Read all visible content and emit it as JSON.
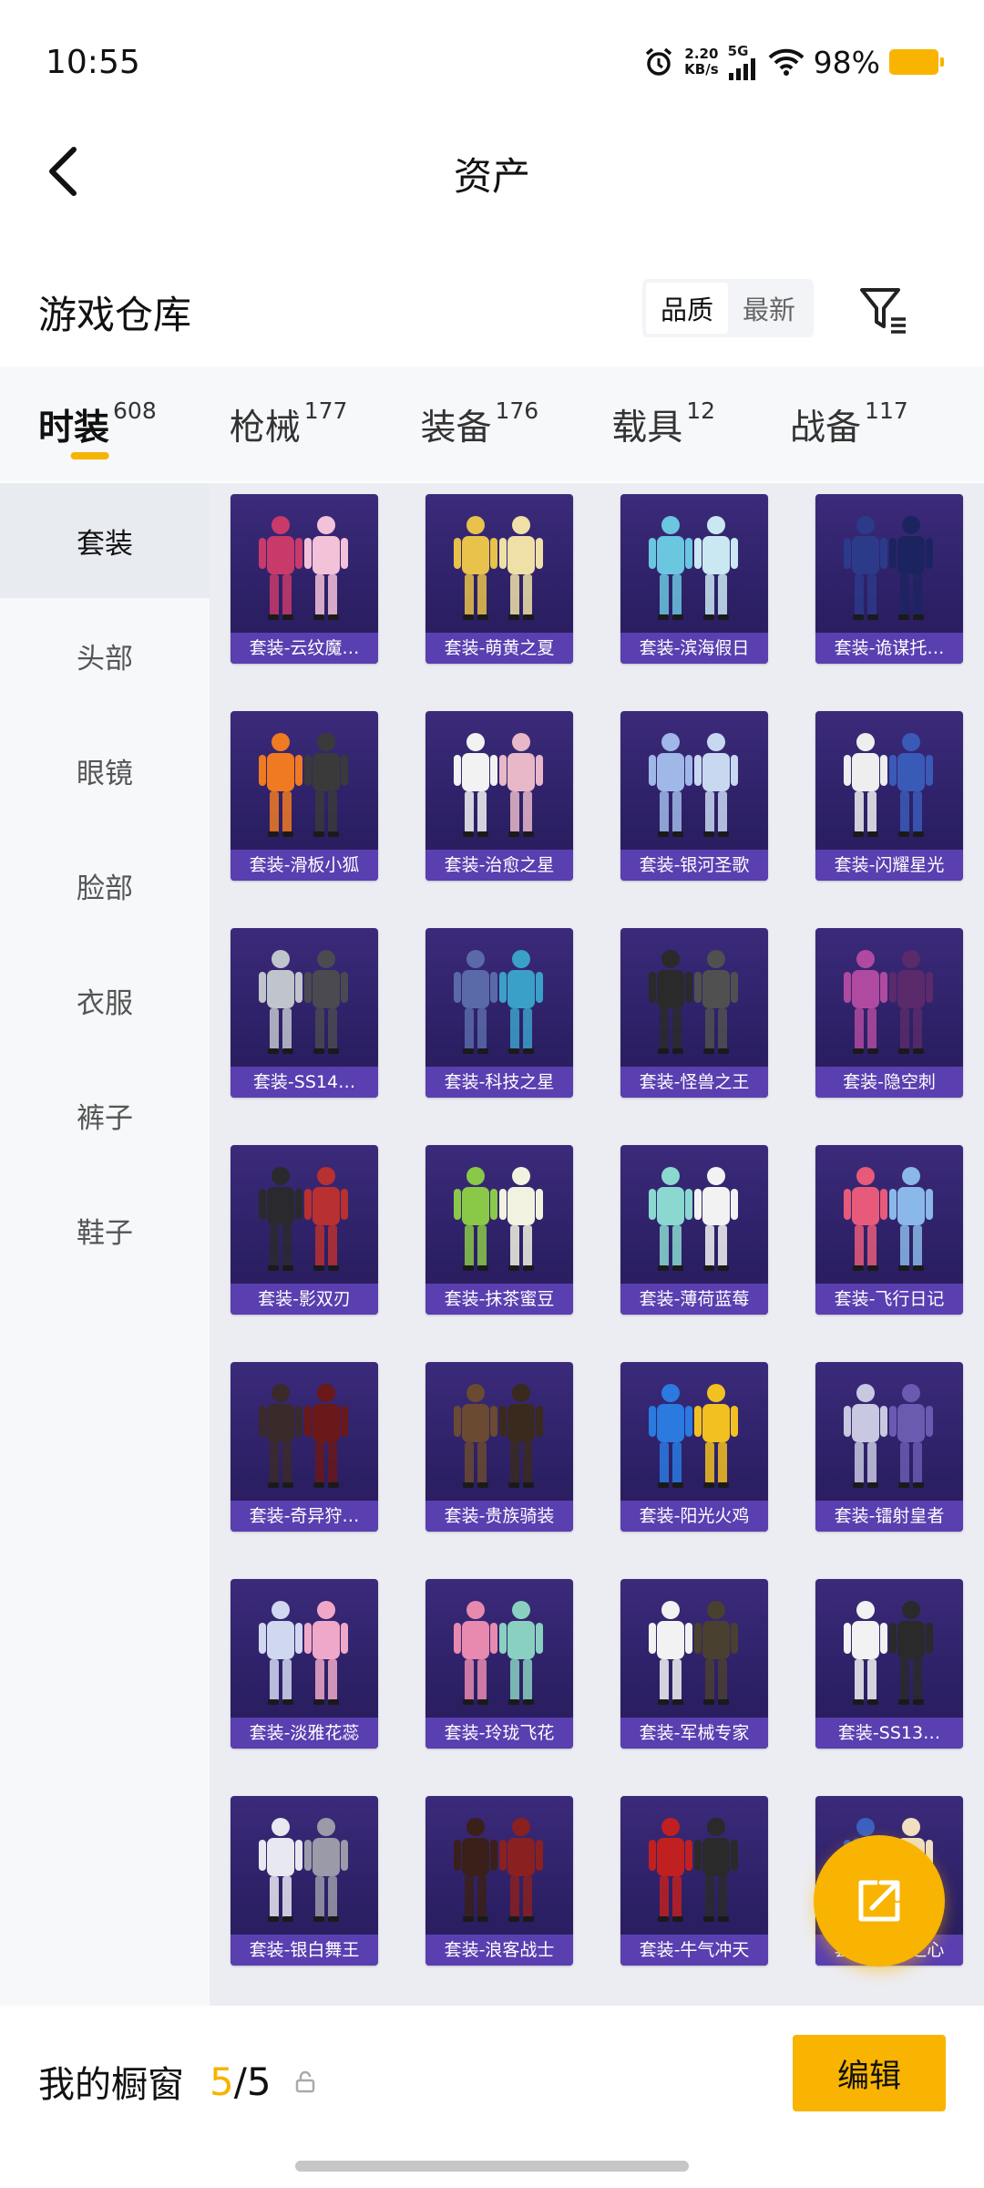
{
  "status_bar": {
    "time": "10:55",
    "net_speed_value": "2.20",
    "net_speed_unit": "KB/s",
    "network": "5G",
    "battery": "98%"
  },
  "nav": {
    "title": "资产"
  },
  "warehouse": {
    "title": "游戏仓库",
    "sort_options": [
      "品质",
      "最新"
    ],
    "active_sort": "品质"
  },
  "tabs": [
    {
      "label": "时装",
      "count": "608",
      "active": true
    },
    {
      "label": "枪械",
      "count": "177"
    },
    {
      "label": "装备",
      "count": "176"
    },
    {
      "label": "载具",
      "count": "12"
    },
    {
      "label": "战备",
      "count": "117"
    }
  ],
  "categories": [
    {
      "label": "套装",
      "active": true
    },
    {
      "label": "头部"
    },
    {
      "label": "眼镜"
    },
    {
      "label": "脸部"
    },
    {
      "label": "衣服"
    },
    {
      "label": "裤子"
    },
    {
      "label": "鞋子"
    }
  ],
  "items": [
    {
      "name": "套装-云纹魔…",
      "colors": [
        "#c83a6a",
        "#f3c2d8"
      ]
    },
    {
      "name": "套装-萌黄之夏",
      "colors": [
        "#e8c24a",
        "#efe0a8"
      ]
    },
    {
      "name": "套装-滨海假日",
      "colors": [
        "#6bc6e0",
        "#c9e8f2"
      ]
    },
    {
      "name": "套装-诡谋托…",
      "colors": [
        "#2c3a8a",
        "#1c2460"
      ]
    },
    {
      "name": "套装-滑板小狐",
      "colors": [
        "#f07a22",
        "#3a3a3a"
      ]
    },
    {
      "name": "套装-治愈之星",
      "colors": [
        "#f2f2f2",
        "#e8b8c8"
      ]
    },
    {
      "name": "套装-银河圣歌",
      "colors": [
        "#9fb8e8",
        "#c8d8f0"
      ]
    },
    {
      "name": "套装-闪耀星光",
      "colors": [
        "#eeeeee",
        "#3a5ab8"
      ]
    },
    {
      "name": "套装-SS14…",
      "colors": [
        "#c0c4cc",
        "#4a4a50"
      ]
    },
    {
      "name": "套装-科技之星",
      "colors": [
        "#5a6aa8",
        "#3aa0c8"
      ]
    },
    {
      "name": "套装-怪兽之王",
      "colors": [
        "#2a2a2a",
        "#505050"
      ]
    },
    {
      "name": "套装-隐空刺",
      "colors": [
        "#b04aa0",
        "#5a2a6a"
      ]
    },
    {
      "name": "套装-影双刃",
      "colors": [
        "#2a2a2e",
        "#b83030"
      ]
    },
    {
      "name": "套装-抹茶蜜豆",
      "colors": [
        "#8ac848",
        "#f2f2e0"
      ]
    },
    {
      "name": "套装-薄荷蓝莓",
      "colors": [
        "#8ad8d0",
        "#f2f2f2"
      ]
    },
    {
      "name": "套装-飞行日记",
      "colors": [
        "#e85a7a",
        "#8ab8e8"
      ]
    },
    {
      "name": "套装-奇异狩…",
      "colors": [
        "#3a2a2a",
        "#6a1818"
      ]
    },
    {
      "name": "套装-贵族骑装",
      "colors": [
        "#6a4a30",
        "#3a2a1e"
      ]
    },
    {
      "name": "套装-阳光火鸡",
      "colors": [
        "#2a7ae0",
        "#f2c020"
      ]
    },
    {
      "name": "套装-镭射皇者",
      "colors": [
        "#c8c8e0",
        "#6a5ab0"
      ]
    },
    {
      "name": "套装-淡雅花蕊",
      "colors": [
        "#d0d8f0",
        "#f0a8c8"
      ]
    },
    {
      "name": "套装-玲珑飞花",
      "colors": [
        "#e88ab0",
        "#8ad0c0"
      ]
    },
    {
      "name": "套装-军械专家",
      "colors": [
        "#f2f2f2",
        "#4a4030"
      ]
    },
    {
      "name": "套装-SS13…",
      "colors": [
        "#f2f2f2",
        "#2a2a2a"
      ]
    },
    {
      "name": "套装-银白舞王",
      "colors": [
        "#e8e8f0",
        "#9a9aa8"
      ]
    },
    {
      "name": "套装-浪客战士",
      "colors": [
        "#3a2018",
        "#8a2020"
      ]
    },
    {
      "name": "套装-牛气冲天",
      "colors": [
        "#c02020",
        "#2a2a2a"
      ]
    },
    {
      "name": "套装-海洋之心",
      "colors": [
        "#3a60c0",
        "#f0e0c0"
      ]
    }
  ],
  "bottom": {
    "showcase_label": "我的橱窗",
    "count_current": "5",
    "count_separator": "/",
    "count_total": "5",
    "edit_label": "编辑"
  },
  "colors": {
    "accent": "#f8b400",
    "card_bg": "#2b1f63",
    "caption_bg": "#5a3fb0"
  },
  "icons": {
    "back": "chevron-left-icon",
    "filter": "filter-icon",
    "lock": "lock-icon",
    "share": "share-out-icon"
  }
}
